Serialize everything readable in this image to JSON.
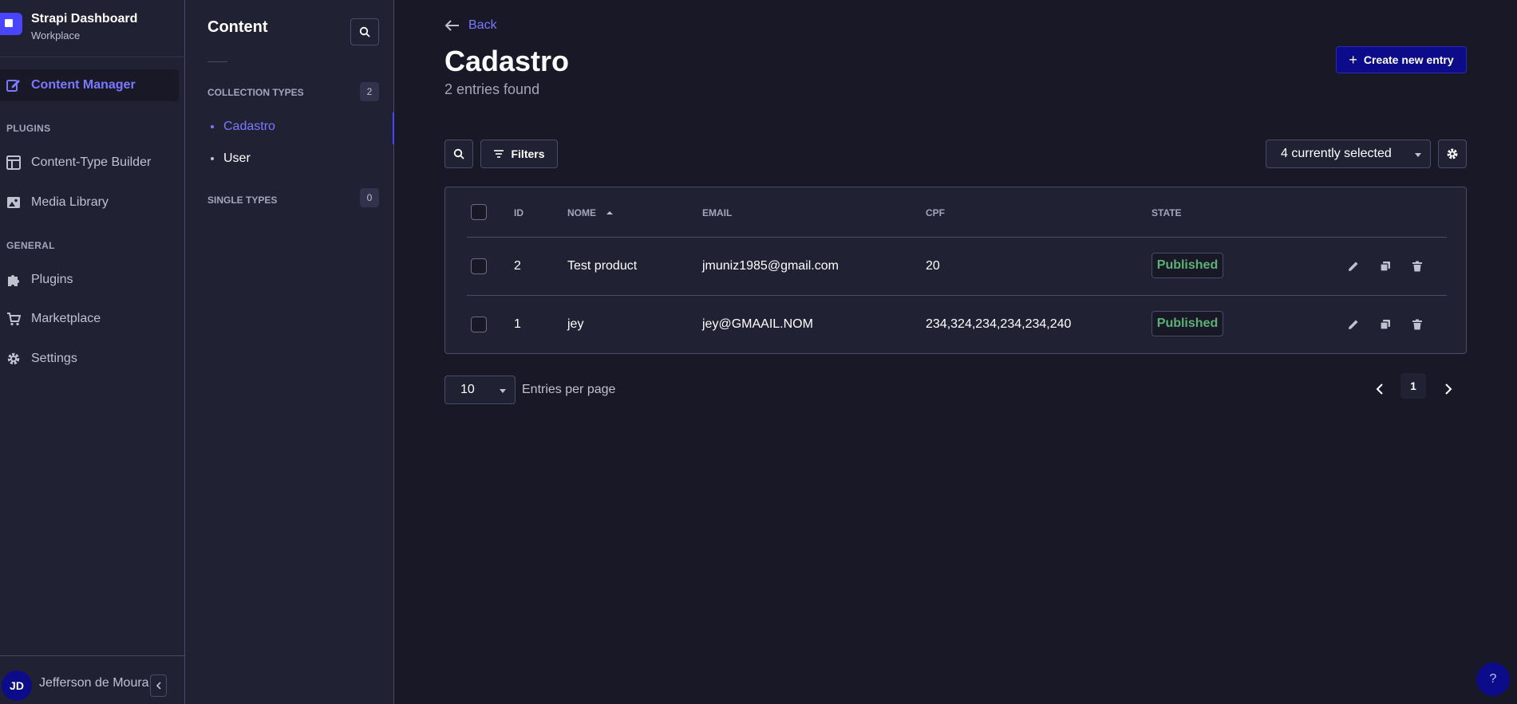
{
  "brand": {
    "title": "Strapi Dashboard",
    "subtitle": "Workplace"
  },
  "nav": {
    "content_manager": "Content Manager",
    "plugins_section": "PLUGINS",
    "content_type_builder": "Content-Type Builder",
    "media_library": "Media Library",
    "general_section": "GENERAL",
    "plugins": "Plugins",
    "marketplace": "Marketplace",
    "settings": "Settings"
  },
  "user": {
    "initials": "JD",
    "name": "Jefferson de Moura"
  },
  "subnav": {
    "title": "Content",
    "collection_types_label": "COLLECTION TYPES",
    "collection_types_count": "2",
    "collection_items": [
      "Cadastro",
      "User"
    ],
    "single_types_label": "SINGLE TYPES",
    "single_types_count": "0"
  },
  "main": {
    "back_label": "Back",
    "title": "Cadastro",
    "subtitle": "2 entries found",
    "create_label": "Create new entry",
    "filters_label": "Filters",
    "columns_selected": "4 currently selected"
  },
  "table": {
    "headers": {
      "id": "ID",
      "nome": "NOME",
      "email": "EMAIL",
      "cpf": "CPF",
      "state": "STATE"
    },
    "rows": [
      {
        "id": "2",
        "nome": "Test product",
        "email": "jmuniz1985@gmail.com",
        "cpf": "20",
        "state": "Published"
      },
      {
        "id": "1",
        "nome": "jey",
        "email": "jey@GMAAIL.NOM",
        "cpf": "234,324,234,234,234,240",
        "state": "Published"
      }
    ]
  },
  "pagination": {
    "per_page": "10",
    "per_page_label": "Entries per page",
    "current_page": "1"
  },
  "help_label": "?",
  "colors": {
    "accent": "#7b79ff",
    "primary_button": "#0c0c8a",
    "published": "#5cb176",
    "background": "#181826",
    "panel": "#212134"
  }
}
